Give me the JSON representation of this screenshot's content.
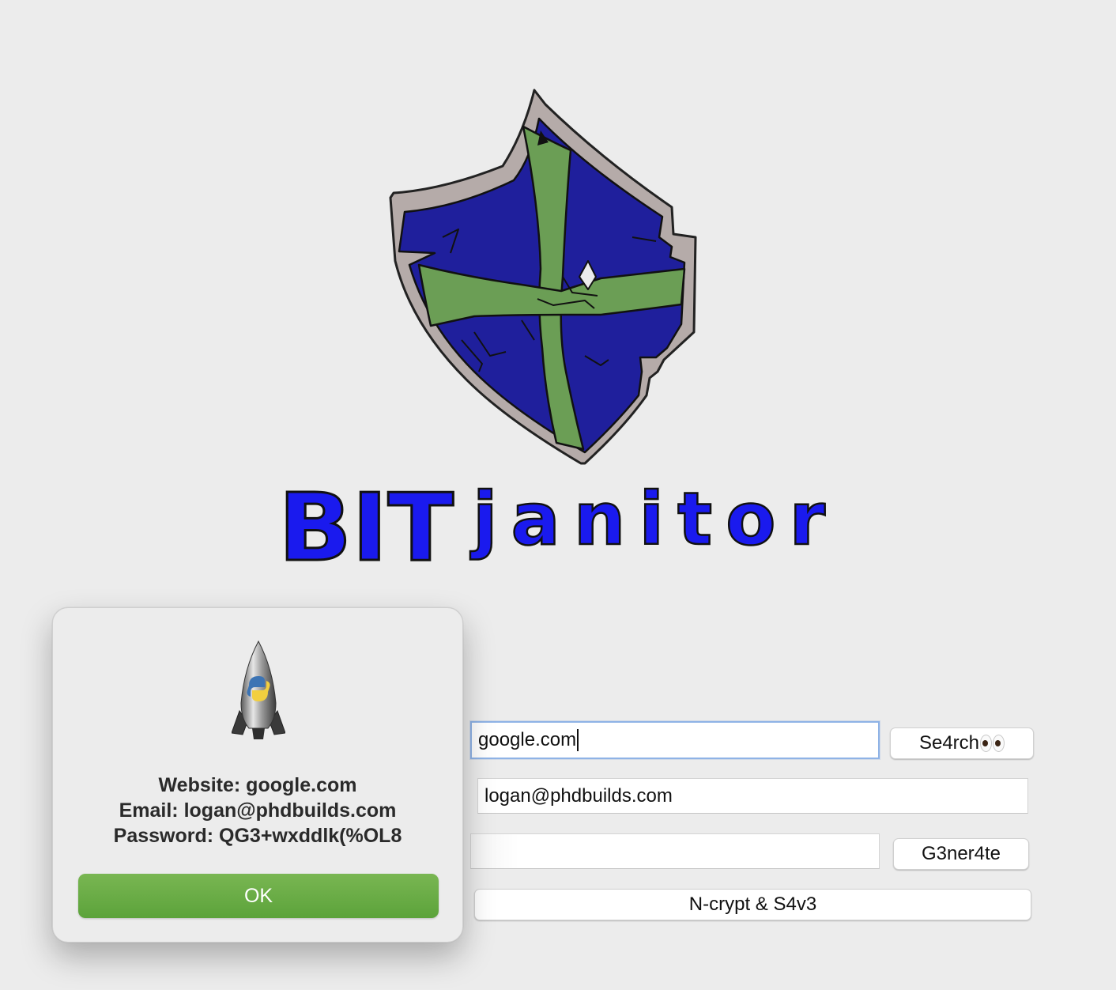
{
  "logo": {
    "wordmark_bold": "BIT",
    "wordmark_script": "janitor",
    "wordmark_color": "#1a1aee",
    "shield_field_color": "#1f1f9c",
    "cross_color": "#6b9e55",
    "shield_rim_color": "#b5aba9"
  },
  "form": {
    "website_value": "google.com",
    "search_label": "Se4rch",
    "search_icon": "eyes-emoji",
    "email_value": "logan@phdbuilds.com",
    "password_value": "",
    "generate_label": "G3ner4te",
    "save_label": "N-crypt & S4v3"
  },
  "dialog": {
    "icon": "python-rocket-icon",
    "line_website": "Website: google.com",
    "line_email": "Email: logan@phdbuilds.com",
    "line_password": "Password: QG3+wxddlk(%OL8",
    "ok_label": "OK",
    "ok_color": "#6aae45"
  }
}
